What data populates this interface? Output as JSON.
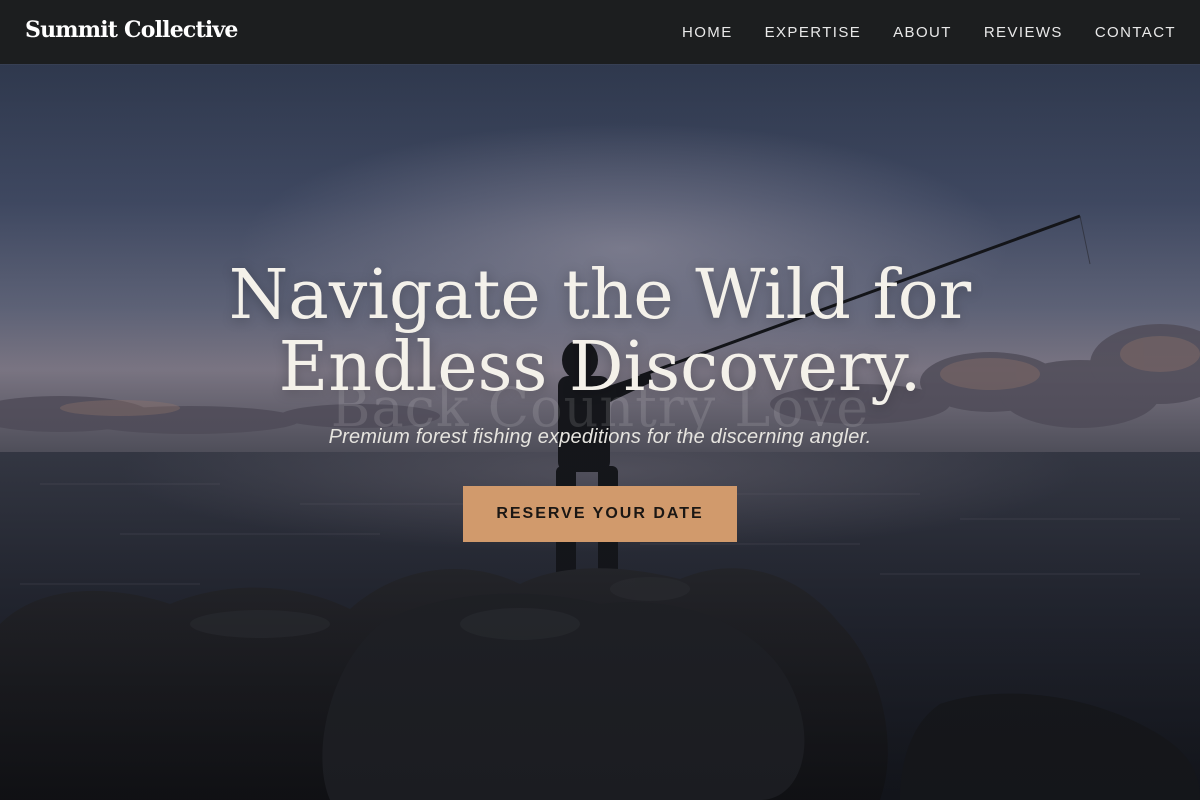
{
  "brand": {
    "name": "Summit Collective"
  },
  "nav": {
    "items": [
      {
        "label": "HOME"
      },
      {
        "label": "EXPERTISE"
      },
      {
        "label": "ABOUT"
      },
      {
        "label": "REVIEWS"
      },
      {
        "label": "CONTACT"
      }
    ]
  },
  "hero": {
    "title_line1": "Navigate the Wild for",
    "title_line2": "Endless Discovery.",
    "ghost_text": "Back Country Love",
    "subtitle": "Premium forest fishing expeditions for the discerning angler.",
    "cta_label": "RESERVE YOUR DATE",
    "background_image": "angler-casting-on-rocks-at-dusk"
  },
  "colors": {
    "nav_background": "#1c1e1f",
    "accent": "#d19a6c",
    "cta_text": "#1b1714",
    "title_text": "#f4f1ea"
  }
}
